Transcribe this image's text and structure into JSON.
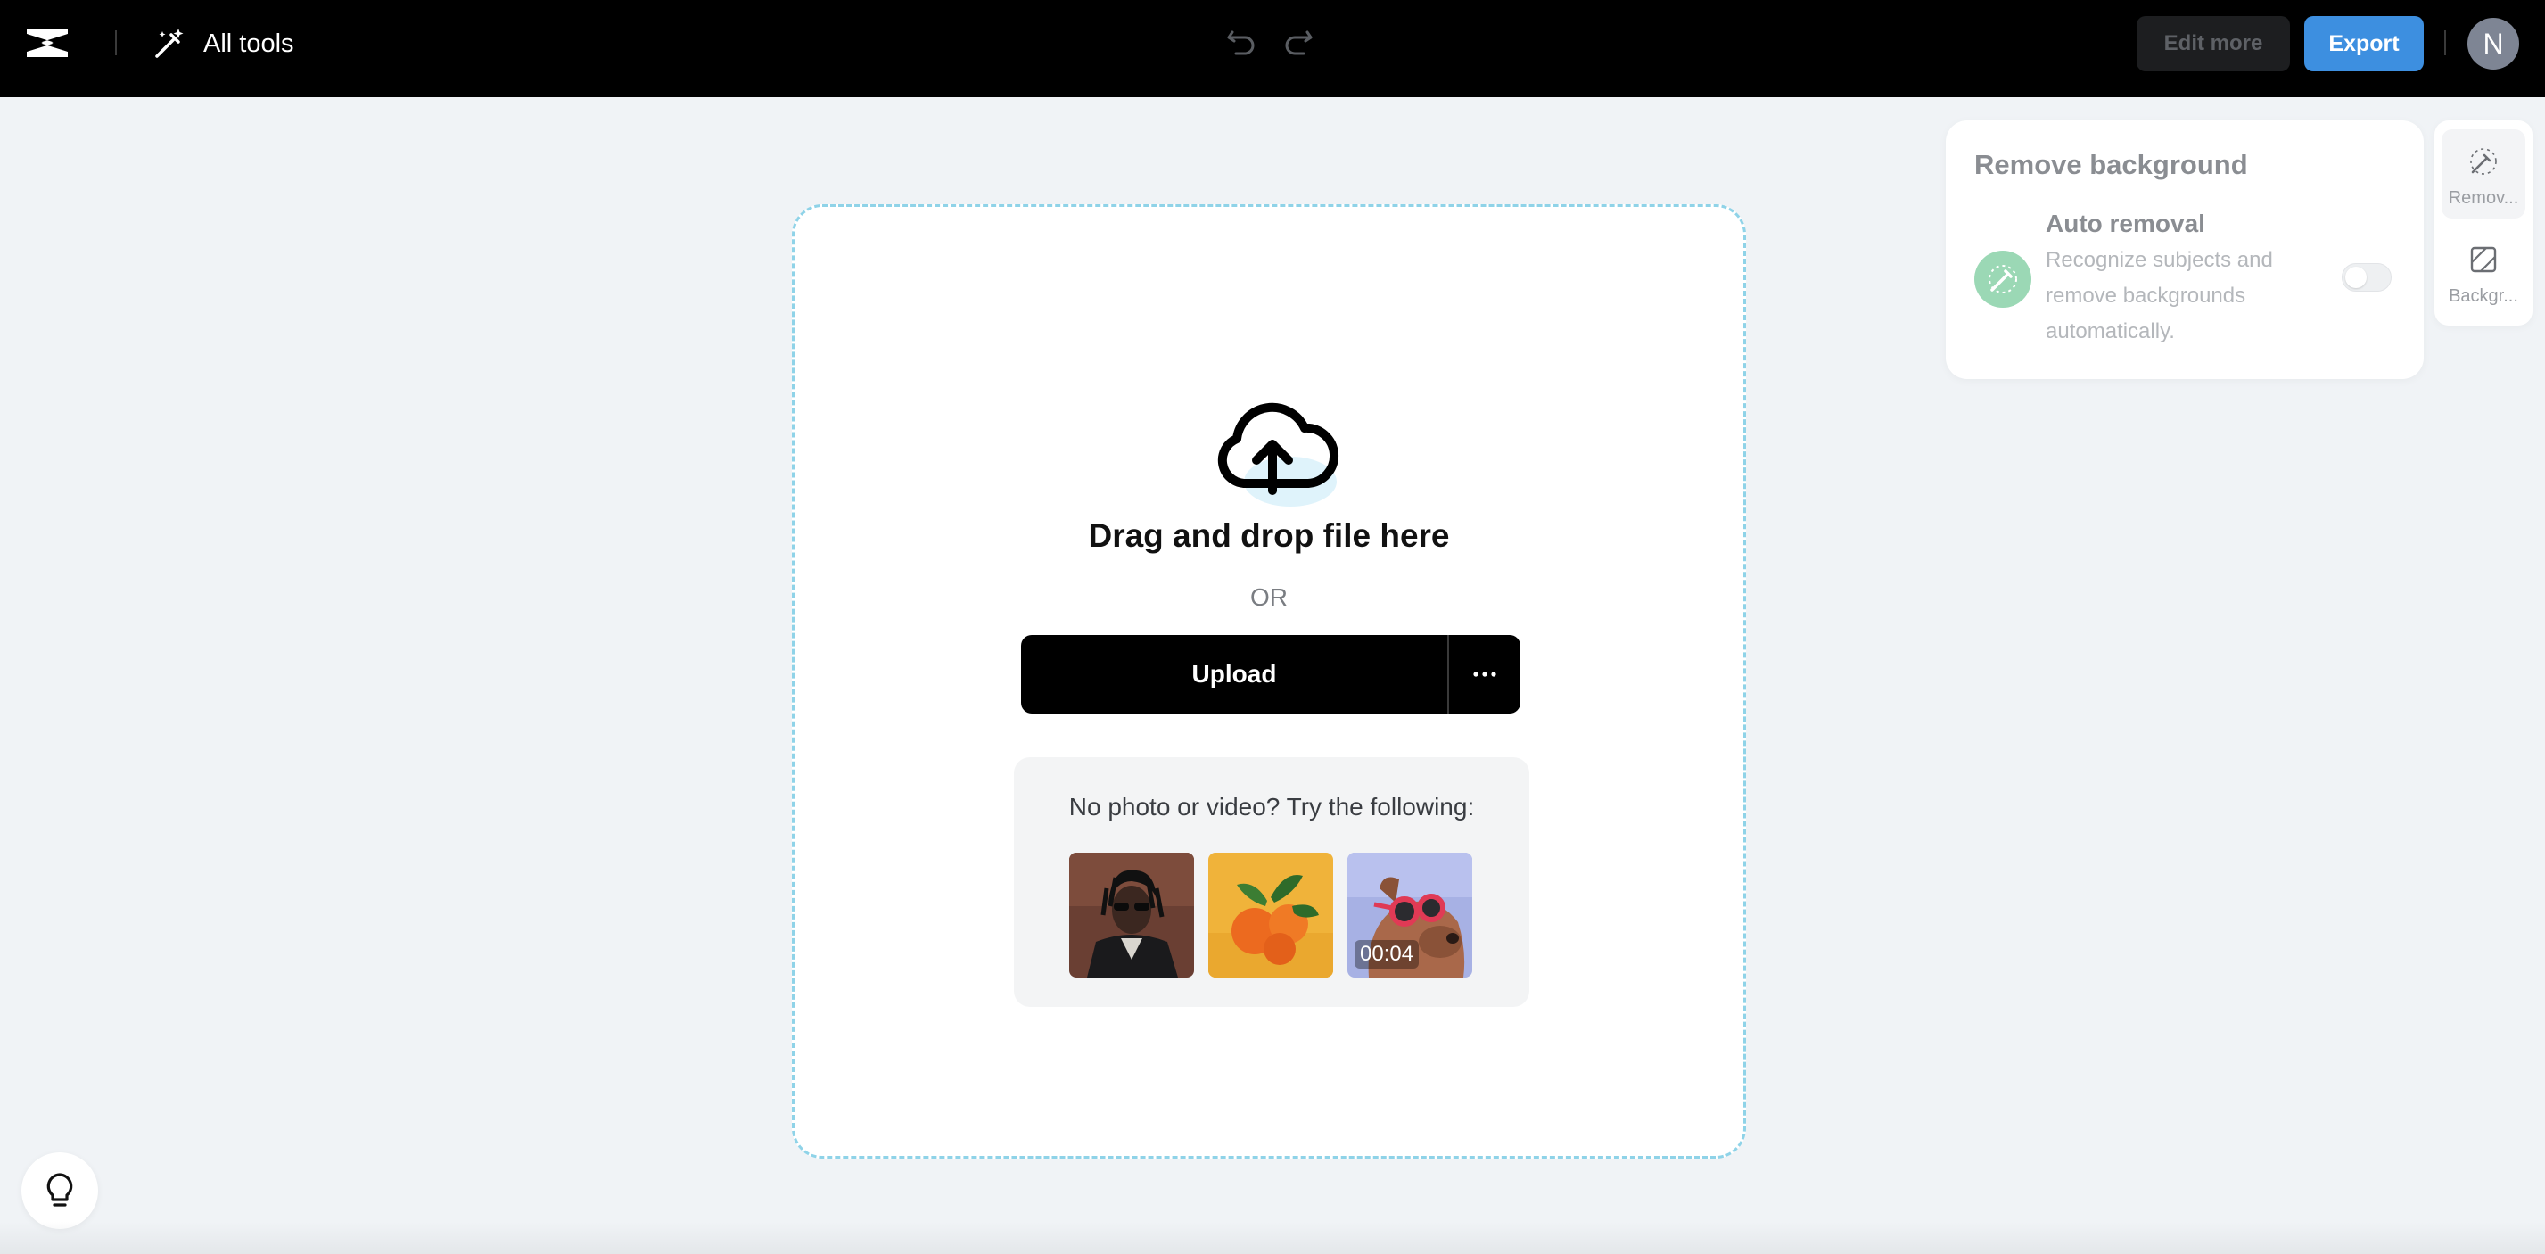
{
  "topbar": {
    "tools_label": "All tools",
    "edit_more_label": "Edit more",
    "export_label": "Export",
    "avatar_initial": "N"
  },
  "upload": {
    "drag_text": "Drag and drop file here",
    "or_text": "OR",
    "upload_label": "Upload",
    "samples_title": "No photo or video? Try the following:",
    "samples": [
      {
        "kind": "photo",
        "subject": "man-in-sunglasses"
      },
      {
        "kind": "photo",
        "subject": "tangerines"
      },
      {
        "kind": "video",
        "subject": "dog-in-goggles",
        "duration": "00:04"
      }
    ]
  },
  "remove_background": {
    "title": "Remove background",
    "option_title": "Auto removal",
    "option_desc": "Recognize subjects and remove backgrounds automatically.",
    "toggle_on": false
  },
  "tool_rail": [
    {
      "label": "Remov...",
      "icon": "magic-eraser-icon",
      "active": true
    },
    {
      "label": "Backgr...",
      "icon": "background-pattern-icon",
      "active": false
    }
  ],
  "colors": {
    "export_blue": "#3d8fe0",
    "dashed_border": "#8fd3e8",
    "auto_removal_green": "#9bd8b5"
  }
}
